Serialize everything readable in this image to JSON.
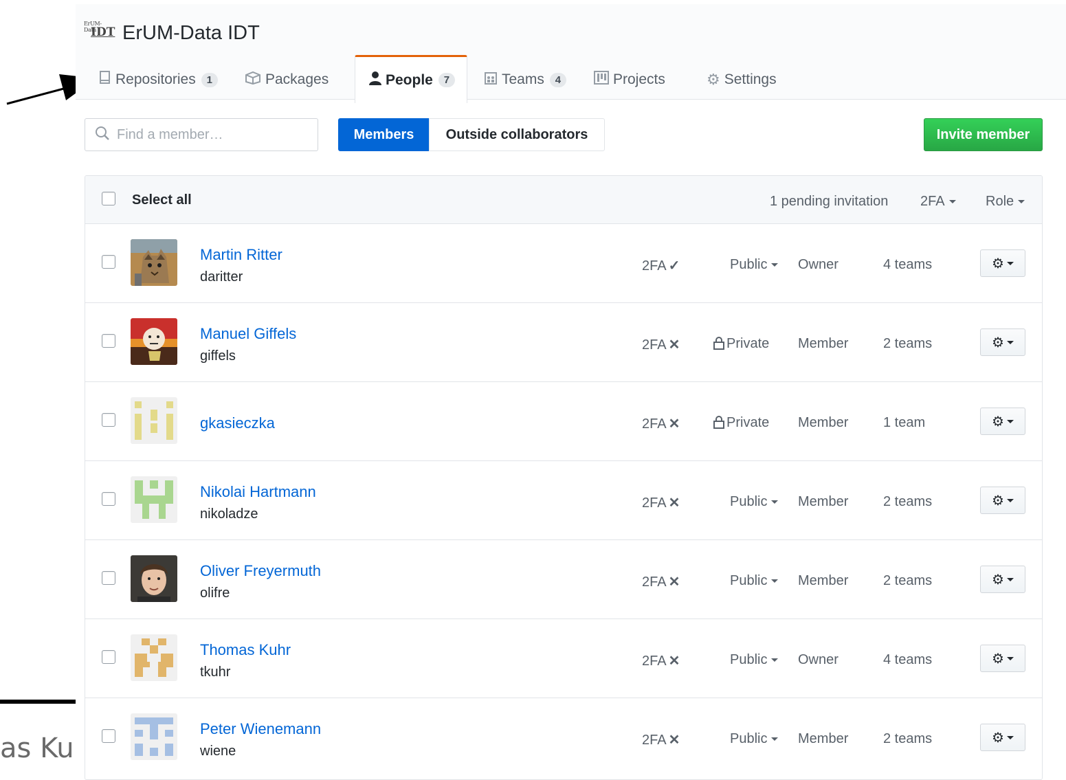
{
  "org": {
    "name": "ErUM-Data IDT",
    "logo_small": "ErUM-Data",
    "logo_big": "IDT"
  },
  "tabs": [
    {
      "label": "Repositories",
      "count": "1",
      "icon": "repo-icon"
    },
    {
      "label": "Packages",
      "count": "",
      "icon": "package-icon"
    },
    {
      "label": "People",
      "count": "7",
      "icon": "person-icon",
      "selected": true
    },
    {
      "label": "Teams",
      "count": "4",
      "icon": "team-icon"
    },
    {
      "label": "Projects",
      "count": "",
      "icon": "project-icon"
    },
    {
      "label": "Settings",
      "count": "",
      "icon": "gear-icon"
    }
  ],
  "toolbar": {
    "search_placeholder": "Find a member…",
    "members_label": "Members",
    "outside_label": "Outside collaborators",
    "invite_label": "Invite member"
  },
  "table_header": {
    "select_all": "Select all",
    "pending": "1 pending invitation",
    "twofa_filter": "2FA",
    "role_filter": "Role"
  },
  "members": [
    {
      "name": "Martin Ritter",
      "login": "daritter",
      "twofa": "2FA",
      "twofa_mark": "✓",
      "visibility": "Public",
      "role": "Owner",
      "teams": "4 teams",
      "avatar": "photo-cat"
    },
    {
      "name": "Manuel Giffels",
      "login": "giffels",
      "twofa": "2FA",
      "twofa_mark": "✕",
      "visibility": "Private",
      "role": "Member",
      "teams": "2 teams",
      "avatar": "cartoon"
    },
    {
      "name": "gkasieczka",
      "login": "",
      "twofa": "2FA",
      "twofa_mark": "✕",
      "visibility": "Private",
      "role": "Member",
      "teams": "1 team",
      "avatar": "identicon-yellow"
    },
    {
      "name": "Nikolai Hartmann",
      "login": "nikoladze",
      "twofa": "2FA",
      "twofa_mark": "✕",
      "visibility": "Public",
      "role": "Member",
      "teams": "2 teams",
      "avatar": "identicon-green"
    },
    {
      "name": "Oliver Freyermuth",
      "login": "olifre",
      "twofa": "2FA",
      "twofa_mark": "✕",
      "visibility": "Public",
      "role": "Member",
      "teams": "2 teams",
      "avatar": "photo-person"
    },
    {
      "name": "Thomas Kuhr",
      "login": "tkuhr",
      "twofa": "2FA",
      "twofa_mark": "✕",
      "visibility": "Public",
      "role": "Owner",
      "teams": "4 teams",
      "avatar": "identicon-orange"
    },
    {
      "name": "Peter Wienemann",
      "login": "wiene",
      "twofa": "2FA",
      "twofa_mark": "✕",
      "visibility": "Public",
      "role": "Member",
      "teams": "2 teams",
      "avatar": "identicon-blue"
    }
  ],
  "annotation": {
    "fragment_text": "as Kuh"
  },
  "colors": {
    "link": "#0366d6",
    "selected_tab_border": "#e36209",
    "invite_green": "#28a745",
    "members_blue": "#0366d6"
  }
}
